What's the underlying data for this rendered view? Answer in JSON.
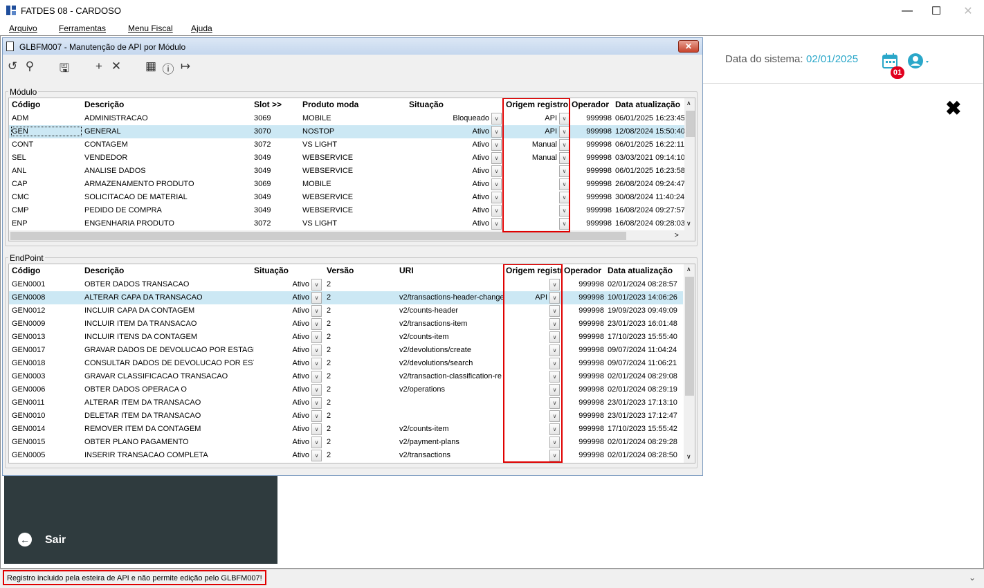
{
  "app": {
    "title": "FATDES 08 - CARDOSO",
    "menu": [
      "Arquivo",
      "Ferramentas",
      "Menu Fiscal",
      "Ajuda"
    ]
  },
  "header": {
    "sysdate_label": "Data do sistema:",
    "sysdate_value": "02/01/2025",
    "calendar_badge": "01"
  },
  "sidebar": {
    "sair": "Sair"
  },
  "status": {
    "message": "Registro incluido pela esteira de API e não permite edição pelo GLBFM007!"
  },
  "child": {
    "title": "GLBFM007 - Manutenção de API por Módulo",
    "toolbar": [
      "undo-icon",
      "search-icon",
      "save-icon",
      "add-icon",
      "delete-icon",
      "calendar-icon",
      "help-icon",
      "exit-icon"
    ]
  },
  "modulo": {
    "label": "Módulo",
    "columns": [
      "Código",
      "Descrição",
      "Slot >>",
      "Produto moda",
      "Situação",
      "Origem registro",
      "Operador",
      "Data atualização"
    ],
    "rows": [
      {
        "codigo": "ADM",
        "descricao": "ADMINISTRACAO",
        "slot": "3069",
        "produto": "MOBILE",
        "situacao": "Bloqueado",
        "origem": "API",
        "operador": "999998",
        "data": "06/01/2025 16:23:45"
      },
      {
        "codigo": "GEN",
        "descricao": "GENERAL",
        "slot": "3070",
        "produto": "NOSTOP",
        "situacao": "Ativo",
        "origem": "API",
        "operador": "999998",
        "data": "12/08/2024 15:50:40"
      },
      {
        "codigo": "CONT",
        "descricao": "CONTAGEM",
        "slot": "3072",
        "produto": "VS LIGHT",
        "situacao": "Ativo",
        "origem": "Manual",
        "operador": "999998",
        "data": "06/01/2025 16:22:11"
      },
      {
        "codigo": "SEL",
        "descricao": "VENDEDOR",
        "slot": "3049",
        "produto": "WEBSERVICE",
        "situacao": "Ativo",
        "origem": "Manual",
        "operador": "999998",
        "data": "03/03/2021 09:14:10"
      },
      {
        "codigo": "ANL",
        "descricao": "ANALISE DADOS",
        "slot": "3049",
        "produto": "WEBSERVICE",
        "situacao": "Ativo",
        "origem": "",
        "operador": "999998",
        "data": "06/01/2025 16:23:58"
      },
      {
        "codigo": "CAP",
        "descricao": "ARMAZENAMENTO PRODUTO",
        "slot": "3069",
        "produto": "MOBILE",
        "situacao": "Ativo",
        "origem": "",
        "operador": "999998",
        "data": "26/08/2024 09:24:47"
      },
      {
        "codigo": "CMC",
        "descricao": "SOLICITACAO DE MATERIAL",
        "slot": "3049",
        "produto": "WEBSERVICE",
        "situacao": "Ativo",
        "origem": "",
        "operador": "999998",
        "data": "30/08/2024 11:40:24"
      },
      {
        "codigo": "CMP",
        "descricao": "PEDIDO DE COMPRA",
        "slot": "3049",
        "produto": "WEBSERVICE",
        "situacao": "Ativo",
        "origem": "",
        "operador": "999998",
        "data": "16/08/2024 09:27:57"
      },
      {
        "codigo": "ENP",
        "descricao": "ENGENHARIA PRODUTO",
        "slot": "3072",
        "produto": "VS LIGHT",
        "situacao": "Ativo",
        "origem": "",
        "operador": "999998",
        "data": "16/08/2024 09:28:03"
      }
    ]
  },
  "endpoint": {
    "label": "EndPoint",
    "columns": [
      "Código",
      "Descrição",
      "Situação",
      "Versão",
      "URI",
      "Origem registro",
      "Operador",
      "Data atualização"
    ],
    "rows": [
      {
        "codigo": "GEN0001",
        "descricao": "OBTER DADOS TRANSACAO",
        "situacao": "Ativo",
        "versao": "2",
        "uri": "",
        "origem": "",
        "operador": "999998",
        "data": "02/01/2024 08:28:57"
      },
      {
        "codigo": "GEN0008",
        "descricao": "ALTERAR CAPA DA TRANSACAO",
        "situacao": "Ativo",
        "versao": "2",
        "uri": "v2/transactions-header-change",
        "origem": "API",
        "operador": "999998",
        "data": "10/01/2023 14:06:26"
      },
      {
        "codigo": "GEN0012",
        "descricao": "INCLUIR CAPA DA CONTAGEM",
        "situacao": "Ativo",
        "versao": "2",
        "uri": "v2/counts-header",
        "origem": "",
        "operador": "999998",
        "data": "19/09/2023 09:49:09"
      },
      {
        "codigo": "GEN0009",
        "descricao": "INCLUIR ITEM DA TRANSACAO",
        "situacao": "Ativo",
        "versao": "2",
        "uri": "v2/transactions-item",
        "origem": "",
        "operador": "999998",
        "data": "23/01/2023 16:01:48"
      },
      {
        "codigo": "GEN0013",
        "descricao": "INCLUIR ITENS DA CONTAGEM",
        "situacao": "Ativo",
        "versao": "2",
        "uri": "v2/counts-item",
        "origem": "",
        "operador": "999998",
        "data": "17/10/2023 15:55:40"
      },
      {
        "codigo": "GEN0017",
        "descricao": "GRAVAR DADOS DE DEVOLUCAO POR ESTAGIO",
        "situacao": "Ativo",
        "versao": "2",
        "uri": "v2/devolutions/create",
        "origem": "",
        "operador": "999998",
        "data": "09/07/2024 11:04:24"
      },
      {
        "codigo": "GEN0018",
        "descricao": "CONSULTAR DADOS DE DEVOLUCAO POR ESTA",
        "situacao": "Ativo",
        "versao": "2",
        "uri": "v2/devolutions/search",
        "origem": "",
        "operador": "999998",
        "data": "09/07/2024 11:06:21"
      },
      {
        "codigo": "GEN0003",
        "descricao": "GRAVAR CLASSIFICACAO TRANSACAO",
        "situacao": "Ativo",
        "versao": "2",
        "uri": "v2/transaction-classification-re",
        "origem": "",
        "operador": "999998",
        "data": "02/01/2024 08:29:08"
      },
      {
        "codigo": "GEN0006",
        "descricao": "OBTER DADOS OPERACA O",
        "situacao": "Ativo",
        "versao": "2",
        "uri": "v2/operations",
        "origem": "",
        "operador": "999998",
        "data": "02/01/2024 08:29:19"
      },
      {
        "codigo": "GEN0011",
        "descricao": "ALTERAR ITEM DA TRANSACAO",
        "situacao": "Ativo",
        "versao": "2",
        "uri": "",
        "origem": "",
        "operador": "999998",
        "data": "23/01/2023 17:13:10"
      },
      {
        "codigo": "GEN0010",
        "descricao": "DELETAR ITEM DA TRANSACAO",
        "situacao": "Ativo",
        "versao": "2",
        "uri": "",
        "origem": "",
        "operador": "999998",
        "data": "23/01/2023 17:12:47"
      },
      {
        "codigo": "GEN0014",
        "descricao": "REMOVER ITEM DA CONTAGEM",
        "situacao": "Ativo",
        "versao": "2",
        "uri": "v2/counts-item",
        "origem": "",
        "operador": "999998",
        "data": "17/10/2023 15:55:42"
      },
      {
        "codigo": "GEN0015",
        "descricao": "OBTER PLANO PAGAMENTO",
        "situacao": "Ativo",
        "versao": "2",
        "uri": "v2/payment-plans",
        "origem": "",
        "operador": "999998",
        "data": "02/01/2024 08:29:28"
      },
      {
        "codigo": "GEN0005",
        "descricao": "INSERIR TRANSACAO COMPLETA",
        "situacao": "Ativo",
        "versao": "2",
        "uri": "v2/transactions",
        "origem": "",
        "operador": "999998",
        "data": "02/01/2024 08:28:50"
      }
    ]
  },
  "colors": {
    "accent": "#2aa7c9",
    "selection": "#cce8f4",
    "highlight_box": "#e00000",
    "dark_panel": "#2f3b3e"
  }
}
